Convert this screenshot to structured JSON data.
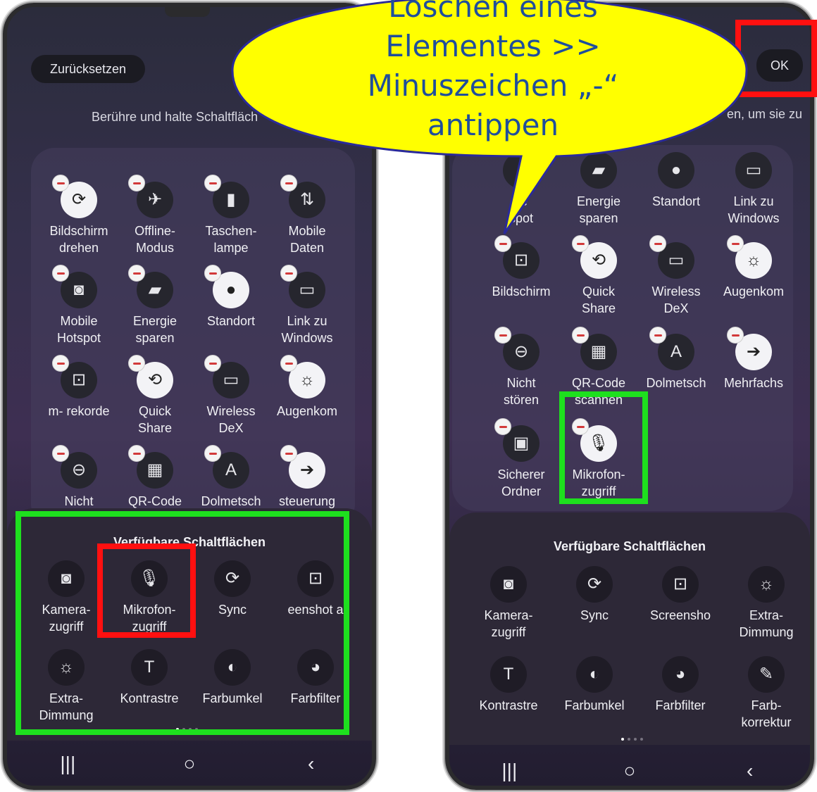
{
  "left": {
    "reset_label": "Zurücksetzen",
    "hint": "Berühre und halte Schaltfläch",
    "tiles": [
      {
        "label": "Bildschirm\ndrehen",
        "icon": "rotate-icon",
        "glyph": "⟳",
        "on": true
      },
      {
        "label": "Offline-\nModus",
        "icon": "airplane-icon",
        "glyph": "✈",
        "on": false
      },
      {
        "label": "Taschen-\nlampe",
        "icon": "flashlight-icon",
        "glyph": "▮",
        "on": false
      },
      {
        "label": "Mobile\nDaten",
        "icon": "data-arrows-icon",
        "glyph": "⇅",
        "on": false
      },
      {
        "label": "Mobile\nHotspot",
        "icon": "hotspot-icon",
        "glyph": "◙",
        "on": false
      },
      {
        "label": "Energie\nsparen",
        "icon": "battery-leaf-icon",
        "glyph": "▰",
        "on": false
      },
      {
        "label": "Standort",
        "icon": "location-pin-icon",
        "glyph": "●",
        "on": true
      },
      {
        "label": "Link zu\nWindows",
        "icon": "link-windows-icon",
        "glyph": "▭",
        "on": false
      },
      {
        "label": "m- rekorde",
        "icon": "screen-recorder-icon",
        "glyph": "⊡",
        "on": false
      },
      {
        "label": "Quick\nShare",
        "icon": "quick-share-icon",
        "glyph": "⟲",
        "on": true
      },
      {
        "label": "Wireless\nDeX",
        "icon": "dex-icon",
        "glyph": "▭",
        "on": false
      },
      {
        "label": "Augenkom",
        "icon": "eye-comfort-icon",
        "glyph": "☼",
        "on": true
      },
      {
        "label": "Nicht",
        "icon": "do-not-disturb-icon",
        "glyph": "⊖",
        "on": false
      },
      {
        "label": "QR-Code",
        "icon": "qr-code-icon",
        "glyph": "▦",
        "on": false
      },
      {
        "label": "Dolmetsch",
        "icon": "interpreter-icon",
        "glyph": "A",
        "on": false
      },
      {
        "label": "steuerung",
        "icon": "multi-control-icon",
        "glyph": "➔",
        "on": true
      }
    ],
    "tray_title": "Verfügbare Schaltflächen",
    "tray_tiles": [
      {
        "label": "Kamera-\nzugriff",
        "icon": "camera-icon",
        "glyph": "◙"
      },
      {
        "label": "Mikrofon-\nzugriff",
        "icon": "microphone-icon",
        "glyph": "🎙"
      },
      {
        "label": "Sync",
        "icon": "sync-icon",
        "glyph": "⟳"
      },
      {
        "label": "eenshot a",
        "icon": "screenshot-icon",
        "glyph": "⊡"
      },
      {
        "label": "Extra-\nDimmung",
        "icon": "extra-dim-icon",
        "glyph": "☼"
      },
      {
        "label": "Kontrastre",
        "icon": "text-contrast-icon",
        "glyph": "T"
      },
      {
        "label": "Farbumkel",
        "icon": "color-inversion-icon",
        "glyph": "◐"
      },
      {
        "label": "Farbfilter",
        "icon": "color-palette-icon",
        "glyph": "◕"
      }
    ],
    "nav": {
      "recent": "|||",
      "home": "○",
      "back": "‹"
    }
  },
  "right": {
    "ok_label": "OK",
    "hint": "en, um sie zu",
    "top_partial": [
      {
        "label": "ile\nspot",
        "icon": "hotspot-icon",
        "glyph": ""
      },
      {
        "label": "Energie\nsparen",
        "icon": "battery-leaf-icon",
        "glyph": "▰"
      },
      {
        "label": "Standort",
        "icon": "location-pin-icon",
        "glyph": "●"
      },
      {
        "label": "Link zu\nWindows",
        "icon": "link-windows-icon",
        "glyph": "▭"
      }
    ],
    "tiles": [
      {
        "label": "Bildschirm",
        "icon": "screen-recorder-icon",
        "glyph": "⊡",
        "on": false
      },
      {
        "label": "Quick\nShare",
        "icon": "quick-share-icon",
        "glyph": "⟲",
        "on": true
      },
      {
        "label": "Wireless\nDeX",
        "icon": "dex-icon",
        "glyph": "▭",
        "on": false
      },
      {
        "label": "Augenkom",
        "icon": "eye-comfort-icon",
        "glyph": "☼",
        "on": true
      },
      {
        "label": "Nicht\nstören",
        "icon": "do-not-disturb-icon",
        "glyph": "⊖",
        "on": false
      },
      {
        "label": "QR-Code\nscannen",
        "icon": "qr-code-icon",
        "glyph": "▦",
        "on": false
      },
      {
        "label": "Dolmetsch",
        "icon": "interpreter-icon",
        "glyph": "A",
        "on": false
      },
      {
        "label": "Mehrfachs",
        "icon": "multi-control-icon",
        "glyph": "➔",
        "on": true
      },
      {
        "label": "Sicherer\nOrdner",
        "icon": "secure-folder-icon",
        "glyph": "▣",
        "on": false
      },
      {
        "label": "Mikrofon-\nzugriff",
        "icon": "microphone-icon",
        "glyph": "🎙",
        "on": true
      }
    ],
    "tray_title": "Verfügbare Schaltflächen",
    "tray_tiles": [
      {
        "label": "Kamera-\nzugriff",
        "icon": "camera-icon",
        "glyph": "◙"
      },
      {
        "label": "Sync",
        "icon": "sync-icon",
        "glyph": "⟳"
      },
      {
        "label": "Screensho",
        "icon": "screenshot-icon",
        "glyph": "⊡"
      },
      {
        "label": "Extra-\nDimmung",
        "icon": "extra-dim-icon",
        "glyph": "☼"
      },
      {
        "label": "Kontrastre",
        "icon": "text-contrast-icon",
        "glyph": "T"
      },
      {
        "label": "Farbumkel",
        "icon": "color-inversion-icon",
        "glyph": "◐"
      },
      {
        "label": "Farbfilter",
        "icon": "color-palette-icon",
        "glyph": "◕"
      },
      {
        "label": "Farb-\nkorrektur",
        "icon": "eyedropper-icon",
        "glyph": "✎"
      }
    ],
    "nav": {
      "recent": "|||",
      "home": "○",
      "back": "‹"
    }
  },
  "callout": {
    "lines": [
      "Löschen eines",
      "Elementes >>",
      "Minuszeichen „-“",
      "antippen"
    ],
    "fill": "#ffff00",
    "text_color": "#1f4e9c",
    "border": "#2a2a9a"
  },
  "colors": {
    "highlight_green": "#1ee01e",
    "highlight_red": "#ff1010"
  }
}
